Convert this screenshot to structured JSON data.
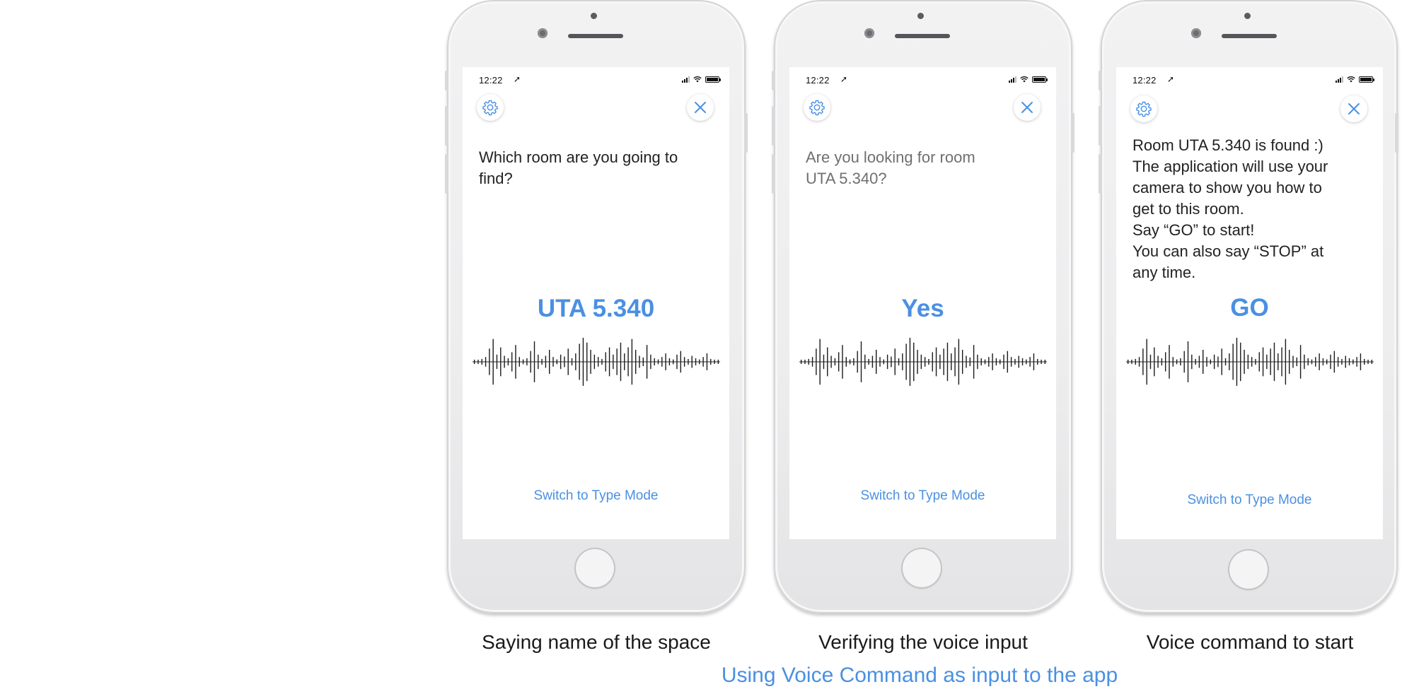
{
  "accent_color": "#4a90e2",
  "screens": [
    {
      "status": {
        "time": "12:22",
        "location_arrow": "➚"
      },
      "prompt_lines": [
        "Which room are you going to",
        "find?"
      ],
      "prompt_style": "dark",
      "recognized": "UTA 5.340",
      "switch_label": "Switch to Type Mode",
      "caption": "Saying name of the space"
    },
    {
      "status": {
        "time": "12:22",
        "location_arrow": "➚"
      },
      "prompt_lines": [
        "Are you looking for room",
        "UTA 5.340?"
      ],
      "prompt_style": "gray",
      "recognized": "Yes",
      "switch_label": "Switch to Type Mode",
      "caption": "Verifying the voice input"
    },
    {
      "status": {
        "time": "12:22",
        "location_arrow": "➚"
      },
      "prompt_lines": [
        "Room UTA 5.340 is found :)",
        "The application will use your",
        "camera to show you how to",
        "get to this room.",
        "Say “GO” to start!",
        "You can also say “STOP” at",
        "any time."
      ],
      "prompt_style": "dark",
      "recognized": "GO",
      "switch_label": "Switch to Type Mode",
      "caption": "Voice command to start"
    }
  ],
  "icons": {
    "settings": "gear-icon",
    "close": "close-icon",
    "waveform": "waveform-icon"
  },
  "footer_title": "Using Voice Command as input to the app"
}
